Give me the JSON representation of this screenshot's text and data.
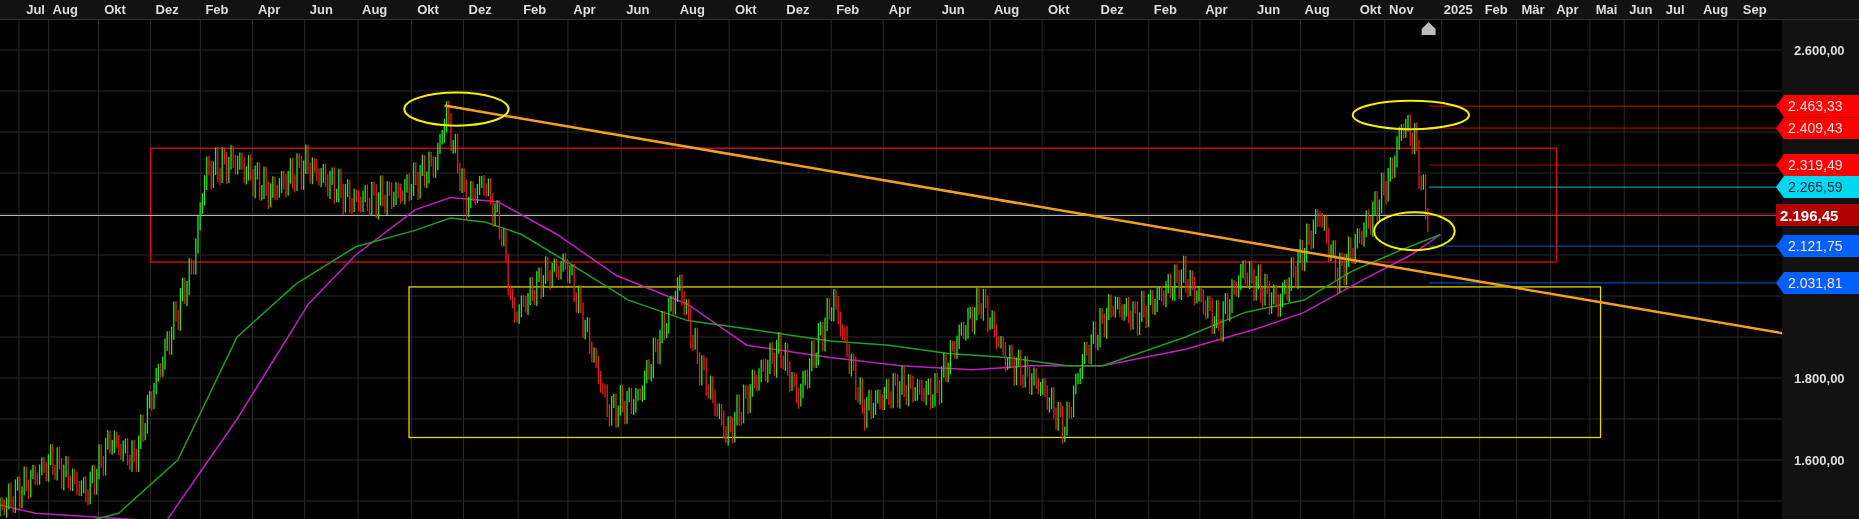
{
  "time_axis": {
    "labels": [
      "Jul",
      "Aug",
      "Okt",
      "Dez",
      "Feb",
      "Apr",
      "Jun",
      "Aug",
      "Okt",
      "Dez",
      "Feb",
      "Apr",
      "Jun",
      "Aug",
      "Okt",
      "Dez",
      "Feb",
      "Apr",
      "Jun",
      "Aug",
      "Okt",
      "Dez",
      "Feb",
      "Apr",
      "Jun",
      "Aug",
      "Okt",
      "Nov",
      "2025",
      "Feb",
      "Mär",
      "Apr",
      "Mai",
      "Jun",
      "Jul",
      "Aug",
      "Sep"
    ]
  },
  "price_axis": {
    "labels": [
      "2.600,00",
      "1.800,00",
      "1.600,00"
    ]
  },
  "price_tags": [
    {
      "text": "2.463,33",
      "color": "#ff0000",
      "kind": "level"
    },
    {
      "text": "2.409,43",
      "color": "#ff0000",
      "kind": "level"
    },
    {
      "text": "2.319,49",
      "color": "#ff0000",
      "kind": "level"
    },
    {
      "text": "2.265,59",
      "color": "#00d8f0",
      "kind": "level"
    },
    {
      "text": "2.196,45",
      "color": "#b00000",
      "kind": "last"
    },
    {
      "text": "2.121,75",
      "color": "#0060ff",
      "kind": "level"
    },
    {
      "text": "2.031,81",
      "color": "#0060ff",
      "kind": "level"
    }
  ]
}
